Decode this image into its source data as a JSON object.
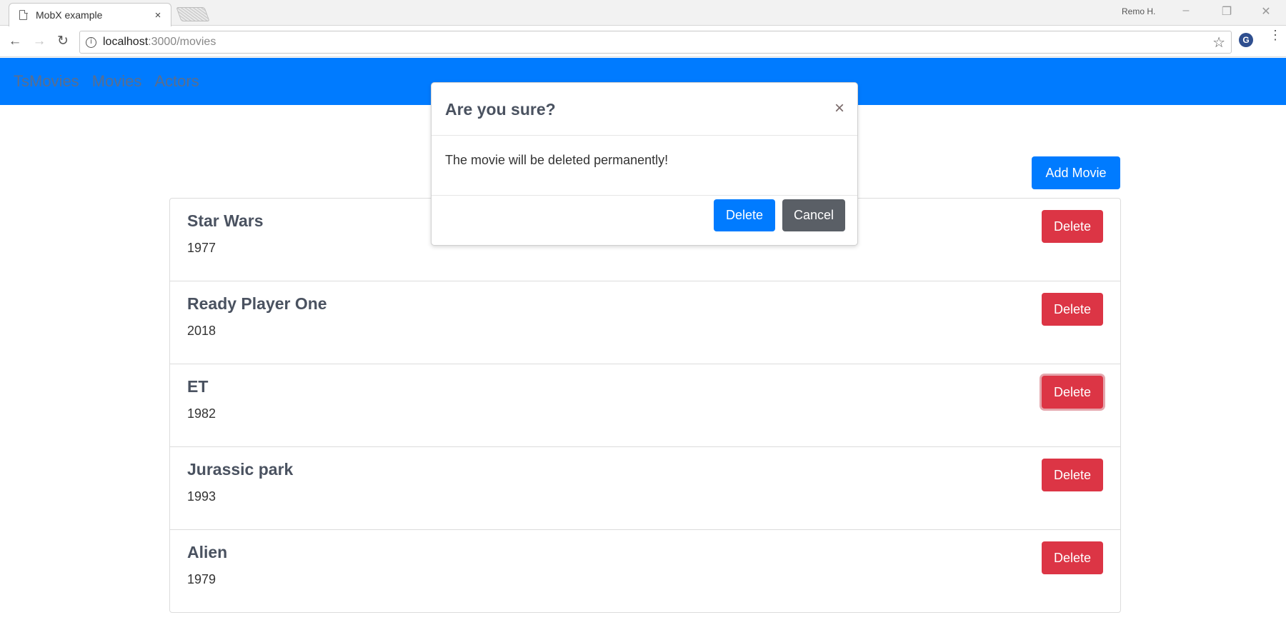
{
  "browser": {
    "tab_title": "MobX example",
    "tab_close": "×",
    "user_label": "Remo H.",
    "url_host": "localhost",
    "url_path": ":3000/movies"
  },
  "navbar": {
    "brand": "TsMovies",
    "links": [
      "Movies",
      "Actors"
    ]
  },
  "toolbar": {
    "add_label": "Add Movie"
  },
  "movies": [
    {
      "title": "Star Wars",
      "year": "1977",
      "delete_label": "Delete"
    },
    {
      "title": "Ready Player One",
      "year": "2018",
      "delete_label": "Delete"
    },
    {
      "title": "ET",
      "year": "1982",
      "delete_label": "Delete"
    },
    {
      "title": "Jurassic park",
      "year": "1993",
      "delete_label": "Delete"
    },
    {
      "title": "Alien",
      "year": "1979",
      "delete_label": "Delete"
    }
  ],
  "modal": {
    "title": "Are you sure?",
    "close": "×",
    "message": "The movie will be deleted permanently!",
    "confirm_label": "Delete",
    "cancel_label": "Cancel"
  },
  "colors": {
    "primary": "#007bff",
    "danger": "#dc3545",
    "secondary": "#5a5f66"
  }
}
